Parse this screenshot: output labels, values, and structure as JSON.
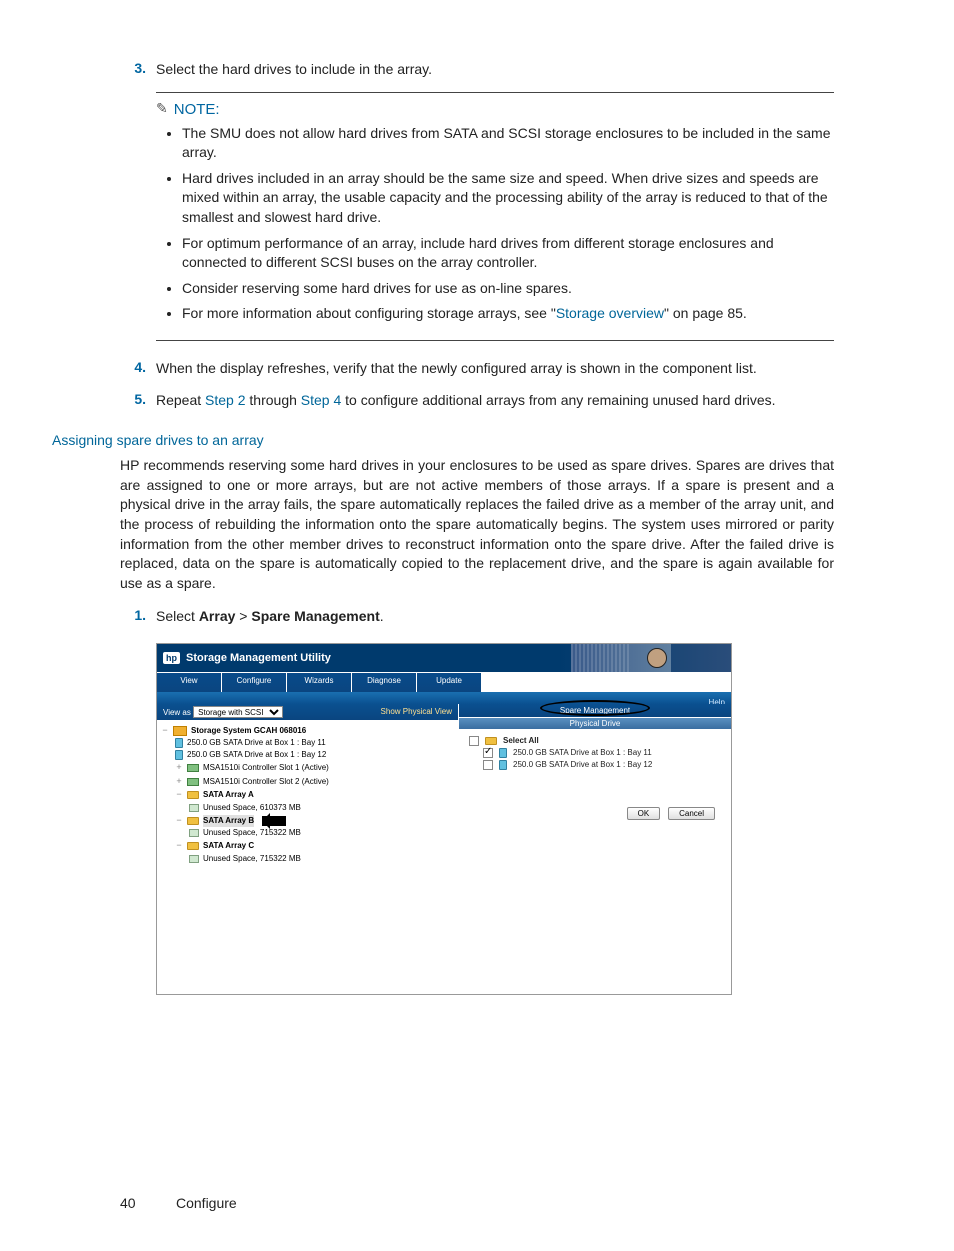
{
  "steps": {
    "s3_num": "3.",
    "s3_text": "Select the hard drives to include in the array.",
    "s4_num": "4.",
    "s4_text_a": "When the display refreshes, verify that the newly configured array is shown in the component list.",
    "s5_num": "5.",
    "s5_text_a": "Repeat ",
    "s5_link1": "Step 2",
    "s5_text_b": " through ",
    "s5_link2": "Step 4",
    "s5_text_c": " to configure additional arrays from any remaining unused hard drives."
  },
  "note": {
    "label": "NOTE:",
    "b1": "The SMU does not allow hard drives from SATA and SCSI storage enclosures to be included in the same array.",
    "b2": "Hard drives included in an array should be the same size and speed. When drive sizes and speeds are mixed within an array, the usable capacity and the processing ability of the array is reduced to that of the smallest and slowest hard drive.",
    "b3": "For optimum performance of an array, include hard drives from different storage enclosures and connected to different SCSI buses on the array controller.",
    "b4": "Consider reserving some hard drives for use as on-line spares.",
    "b5a": "For more information about configuring storage arrays, see \"",
    "b5link": "Storage overview",
    "b5b": "\" on page 85."
  },
  "subhead": "Assigning spare drives to an array",
  "para": "HP recommends reserving some hard drives in your enclosures to be used as spare drives. Spares are drives that are assigned to one or more arrays, but are not active members of those arrays. If a spare is present and a physical drive in the array fails, the spare automatically replaces the failed drive as a member of the array unit, and the process of rebuilding the information onto the spare automatically begins. The system uses mirrored or parity information from the other member drives to reconstruct information onto the spare drive. After the failed drive is replaced, data on the spare is automatically copied to the replacement drive, and the spare is again available for use as a spare.",
  "step_spare_num": "1.",
  "step_spare_a": "Select ",
  "step_spare_b": "Array",
  "step_spare_c": " > ",
  "step_spare_d": "Spare Management",
  "step_spare_e": ".",
  "figure": {
    "title": "Storage Management Utility",
    "menus": [
      "View",
      "Configure",
      "Wizards",
      "Diagnose",
      "Update"
    ],
    "help": "Help",
    "viewas_label": "View as",
    "viewas_value": "Storage with SCSI",
    "show_physical": "Show Physical View",
    "tree": {
      "root": "Storage System GCAH 068016",
      "drv1": "250.0 GB SATA Drive at Box 1 : Bay 11",
      "drv2": "250.0 GB SATA Drive at Box 1 : Bay 12",
      "ctrl1": "MSA1510i Controller Slot 1 (Active)",
      "ctrl2": "MSA1510i Controller Slot 2 (Active)",
      "arrA": "SATA Array A",
      "arrA_sp": "Unused Space, 610373 MB",
      "arrB": "SATA Array B",
      "arrB_sp": "Unused Space, 715322 MB",
      "arrC": "SATA Array C",
      "arrC_sp": "Unused Space, 715322 MB"
    },
    "right_title": "Spare Management",
    "right_sub": "Physical Drive",
    "select_all": "Select All",
    "r_drv1": "250.0 GB SATA Drive at Box 1 : Bay 11",
    "r_drv2": "250.0 GB SATA Drive at Box 1 : Bay 12",
    "ok": "OK",
    "cancel": "Cancel"
  },
  "footer": {
    "page": "40",
    "chapter": "Configure"
  }
}
